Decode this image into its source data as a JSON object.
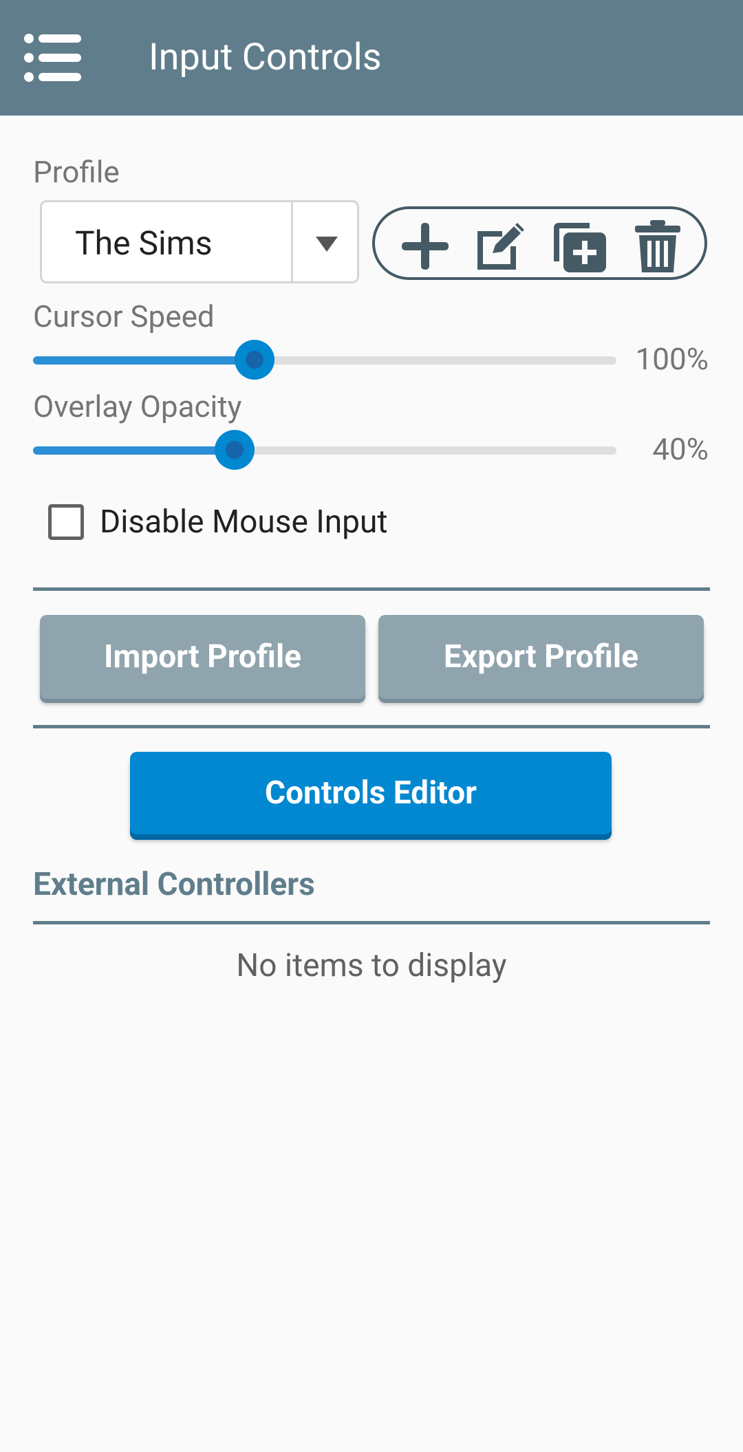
{
  "header": {
    "title": "Input Controls",
    "menu_icon": "list-menu-icon",
    "background": "#607d8b"
  },
  "profile": {
    "label": "Profile",
    "selected": "The Sims",
    "actions": [
      {
        "name": "add-profile-button",
        "icon": "plus-icon"
      },
      {
        "name": "edit-profile-button",
        "icon": "edit-icon"
      },
      {
        "name": "duplicate-profile-button",
        "icon": "copy-plus-icon"
      },
      {
        "name": "delete-profile-button",
        "icon": "trash-icon"
      }
    ]
  },
  "cursor_speed": {
    "label": "Cursor Speed",
    "value_text": "100%",
    "fraction": 0.38
  },
  "overlay_opacity": {
    "label": "Overlay Opacity",
    "value_text": "40%",
    "fraction": 0.345
  },
  "disable_mouse": {
    "label": "Disable Mouse Input",
    "checked": false
  },
  "buttons": {
    "import": "Import Profile",
    "export": "Export Profile",
    "controls_editor": "Controls Editor"
  },
  "external": {
    "title": "External Controllers",
    "empty": "No items to display"
  },
  "colors": {
    "accent": "#0288d1",
    "secondary_button": "#90a4ae",
    "divider": "#607d8b"
  }
}
